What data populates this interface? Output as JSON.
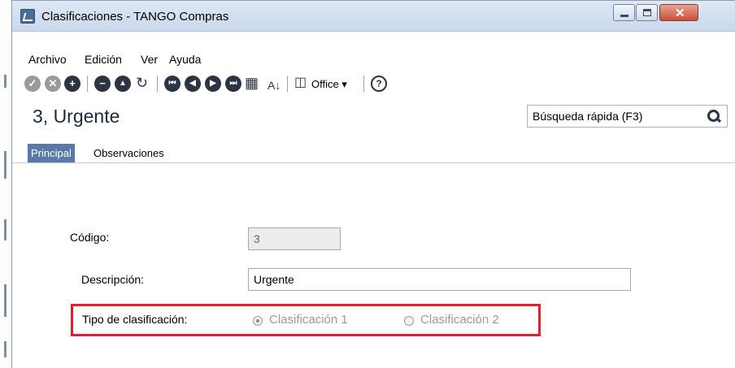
{
  "window": {
    "title": "Clasificaciones - TANGO Compras"
  },
  "menu": [
    "Archivo",
    "Edición",
    "Ver",
    "Ayuda"
  ],
  "toolbar": {
    "office_label": "Office",
    "office_arrow": "▾",
    "help_glyph": "?"
  },
  "record": {
    "title": "3, Urgente"
  },
  "search": {
    "placeholder": "Búsqueda rápida (F3)"
  },
  "tabs": [
    "Principal",
    "Observaciones"
  ],
  "form": {
    "codigo_label": "Código:",
    "codigo_value": "3",
    "descripcion_label": "Descripción:",
    "descripcion_value": "Urgente",
    "tipo_label": "Tipo de clasificación:",
    "options": [
      {
        "label": "Clasificación 1",
        "selected": true
      },
      {
        "label": "Clasificación 2",
        "selected": false
      }
    ]
  },
  "colors": {
    "highlight": "#e0202a",
    "active_tab": "#5a79a6"
  }
}
